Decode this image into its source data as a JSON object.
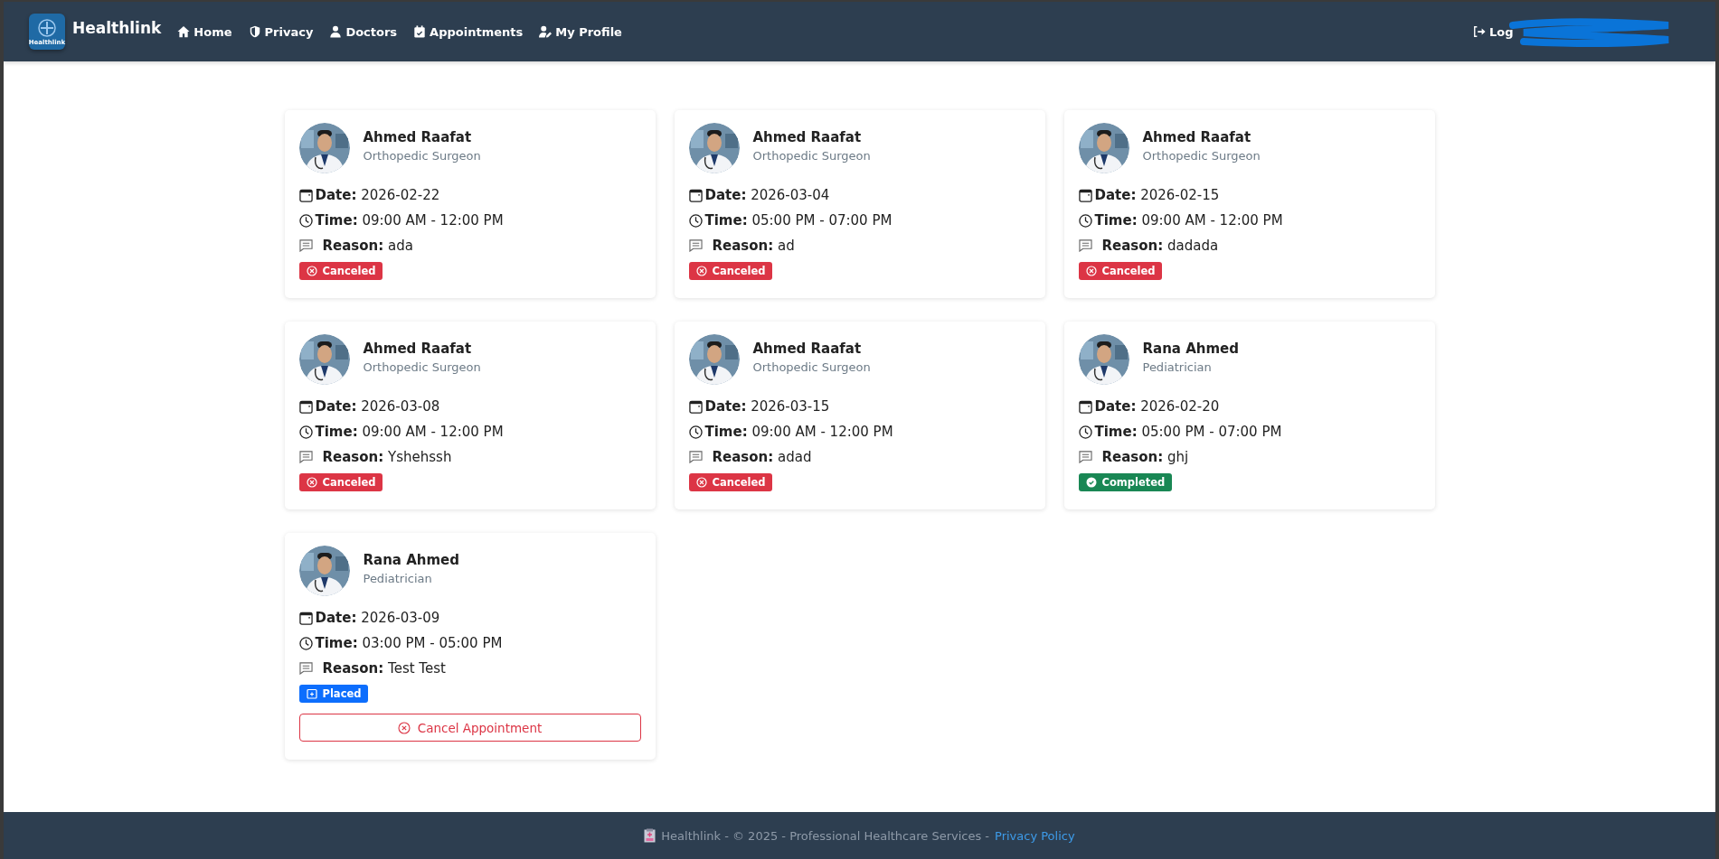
{
  "navbar": {
    "brand": "Healthlink",
    "logo_caption": "Healthlink",
    "links": [
      {
        "label": "Home"
      },
      {
        "label": "Privacy"
      },
      {
        "label": "Doctors"
      },
      {
        "label": "Appointments"
      },
      {
        "label": "My Profile"
      }
    ],
    "right_link": {
      "label": "Log",
      "redacted": true
    }
  },
  "appointments": [
    {
      "doctor": "Ahmed Raafat",
      "specialty": "Orthopedic Surgeon",
      "date_label": "Date:",
      "date": "2026-02-22",
      "time_label": "Time:",
      "time": "09:00 AM - 12:00 PM",
      "reason_label": "Reason:",
      "reason": "ada",
      "status": {
        "kind": "canceled",
        "label": "Canceled"
      }
    },
    {
      "doctor": "Ahmed Raafat",
      "specialty": "Orthopedic Surgeon",
      "date_label": "Date:",
      "date": "2026-03-04",
      "time_label": "Time:",
      "time": "05:00 PM - 07:00 PM",
      "reason_label": "Reason:",
      "reason": "ad",
      "status": {
        "kind": "canceled",
        "label": "Canceled"
      }
    },
    {
      "doctor": "Ahmed Raafat",
      "specialty": "Orthopedic Surgeon",
      "date_label": "Date:",
      "date": "2026-02-15",
      "time_label": "Time:",
      "time": "09:00 AM - 12:00 PM",
      "reason_label": "Reason:",
      "reason": "dadada",
      "status": {
        "kind": "canceled",
        "label": "Canceled"
      }
    },
    {
      "doctor": "Ahmed Raafat",
      "specialty": "Orthopedic Surgeon",
      "date_label": "Date:",
      "date": "2026-03-08",
      "time_label": "Time:",
      "time": "09:00 AM - 12:00 PM",
      "reason_label": "Reason:",
      "reason": "Yshehssh",
      "status": {
        "kind": "canceled",
        "label": "Canceled"
      }
    },
    {
      "doctor": "Ahmed Raafat",
      "specialty": "Orthopedic Surgeon",
      "date_label": "Date:",
      "date": "2026-03-15",
      "time_label": "Time:",
      "time": "09:00 AM - 12:00 PM",
      "reason_label": "Reason:",
      "reason": "adad",
      "status": {
        "kind": "canceled",
        "label": "Canceled"
      }
    },
    {
      "doctor": "Rana Ahmed",
      "specialty": "Pediatrician",
      "date_label": "Date:",
      "date": "2026-02-20",
      "time_label": "Time:",
      "time": "05:00 PM - 07:00 PM",
      "reason_label": "Reason:",
      "reason": "ghj",
      "status": {
        "kind": "completed",
        "label": "Completed"
      }
    },
    {
      "doctor": "Rana Ahmed",
      "specialty": "Pediatrician",
      "date_label": "Date:",
      "date": "2026-03-09",
      "time_label": "Time:",
      "time": "03:00 PM - 05:00 PM",
      "reason_label": "Reason:",
      "reason": "Test Test",
      "status": {
        "kind": "placed",
        "label": "Placed"
      },
      "action": "Cancel Appointment"
    }
  ],
  "footer": {
    "text": "Healthlink - © 2025 - Professional Healthcare Services -",
    "link": "Privacy Policy"
  }
}
